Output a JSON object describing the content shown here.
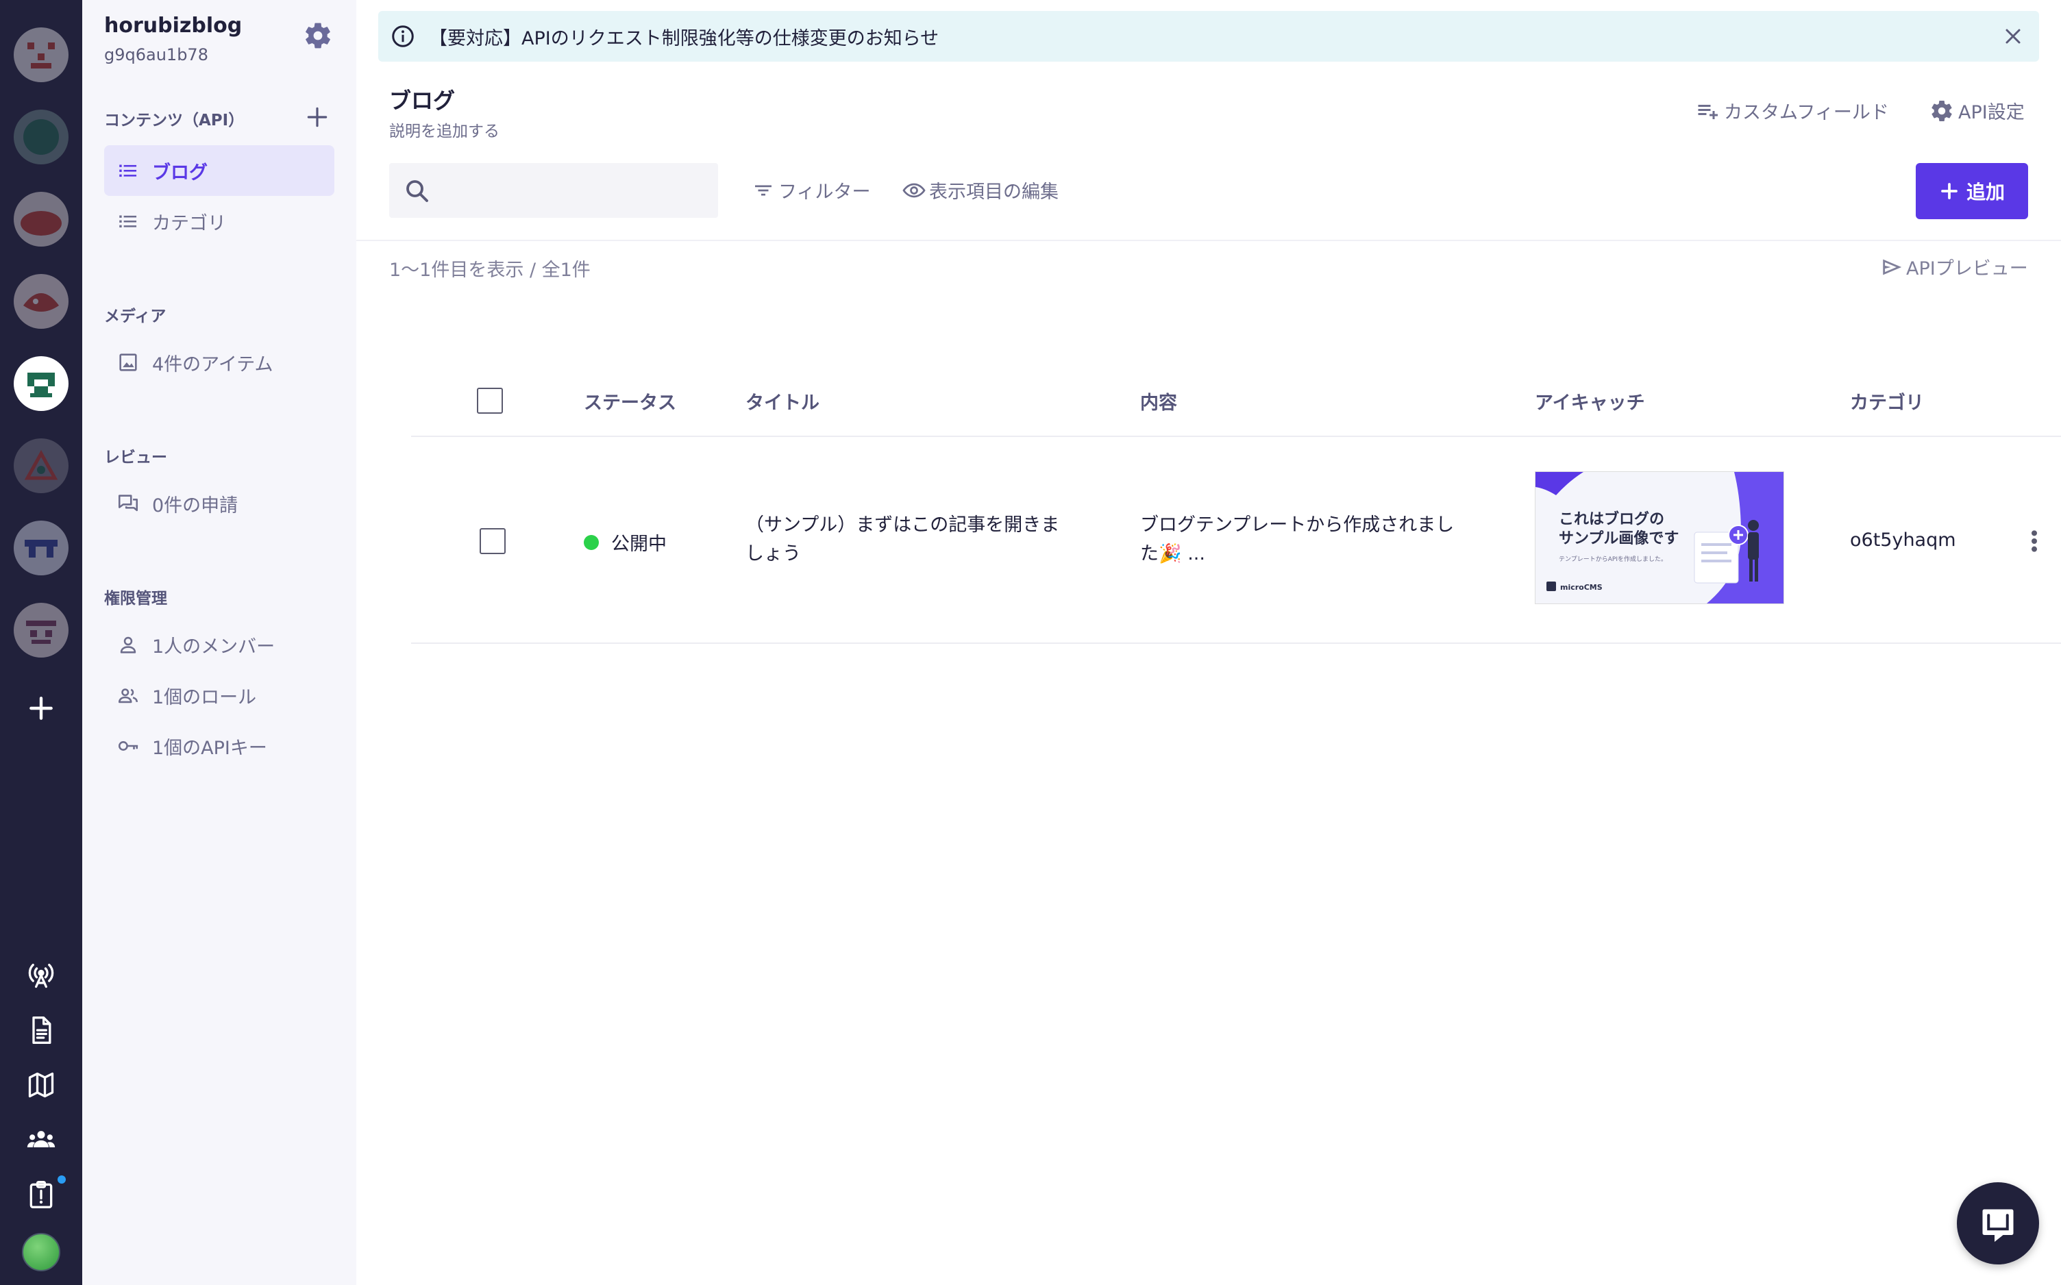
{
  "banner": {
    "text": "【要対応】APIのリクエスト制限強化等の仕様変更のお知らせ"
  },
  "service": {
    "name": "horubizblog",
    "id": "g9q6au1b78"
  },
  "sidebar": {
    "contents_heading": "コンテンツ（API）",
    "contents": [
      {
        "label": "ブログ",
        "active": true
      },
      {
        "label": "カテゴリ",
        "active": false
      }
    ],
    "media_heading": "メディア",
    "media_item": "4件のアイテム",
    "review_heading": "レビュー",
    "review_item": "0件の申請",
    "permission_heading": "権限管理",
    "permission_items": [
      "1人のメンバー",
      "1個のロール",
      "1個のAPIキー"
    ]
  },
  "page": {
    "title": "ブログ",
    "description": "説明を追加する",
    "custom_field": "カスタムフィールド",
    "api_settings": "API設定",
    "filter": "フィルター",
    "edit_columns": "表示項目の編集",
    "add_button": "追加",
    "search_placeholder": "",
    "count": "1〜1件目を表示 / 全1件",
    "api_preview": "APIプレビュー"
  },
  "table": {
    "columns": [
      "ステータス",
      "タイトル",
      "内容",
      "アイキャッチ",
      "カテゴリ"
    ],
    "rows": [
      {
        "status": "公開中",
        "title_line1": "（サンプル）まずはこの記事を開きま",
        "title_line2": "しょう",
        "content_line1": "ブログテンプレートから作成されまし",
        "content_line2": "た🎉 ...",
        "eyecatch_line1": "これはブログの",
        "eyecatch_line2": "サンプル画像です",
        "eyecatch_sub": "テンプレートからAPIを作成しました。",
        "eyecatch_logo": "microCMS",
        "category": "o6t5yhaqm"
      }
    ]
  },
  "colors": {
    "rail": "#21213b",
    "accent": "#5a38e6",
    "banner": "#e6f5f8",
    "published": "#2bd14a"
  }
}
